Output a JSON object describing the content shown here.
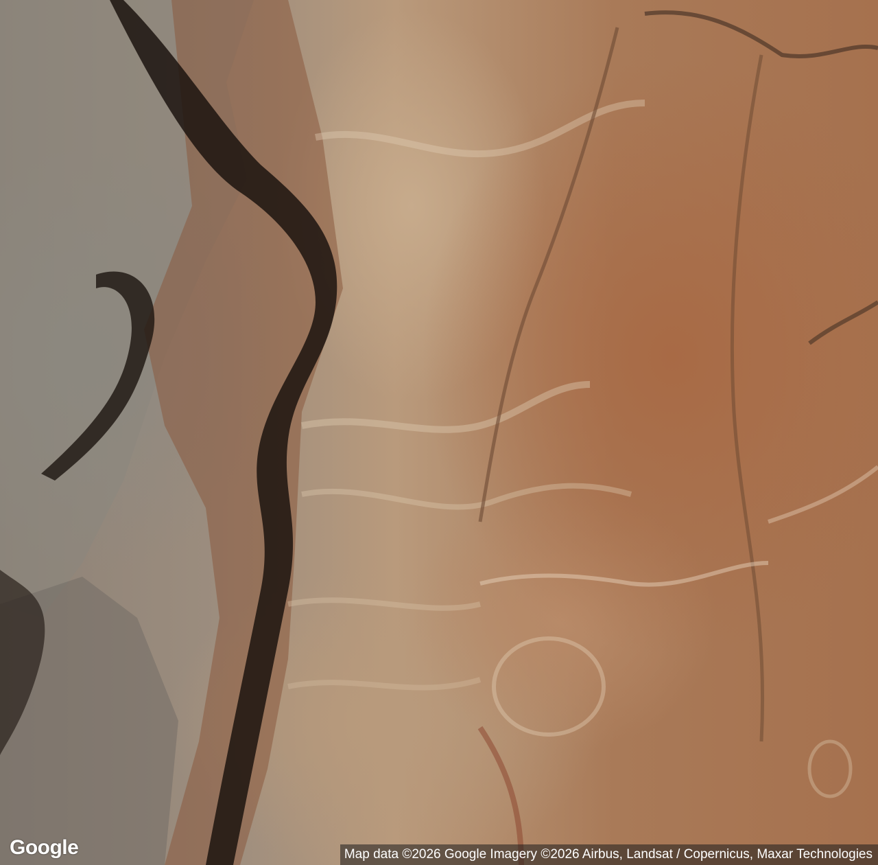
{
  "map": {
    "type": "satellite",
    "logo": "Google",
    "attribution": "Map data ©2026 Google Imagery ©2026 Airbus, Landsat / Copernicus, Maxar Technologies"
  }
}
